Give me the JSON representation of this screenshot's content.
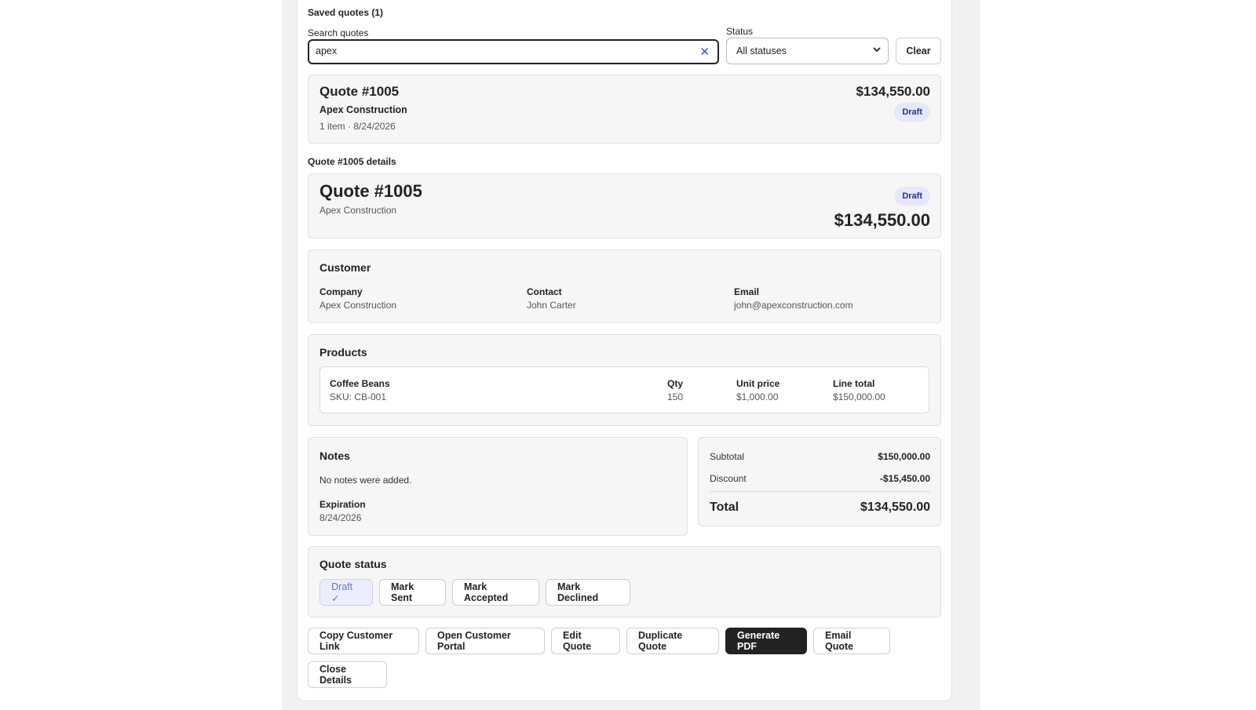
{
  "saved_quotes": {
    "heading": "Saved quotes (1)",
    "search_label": "Search quotes",
    "search_value": "apex",
    "status_label": "Status",
    "status_selected": "All statuses",
    "clear_label": "Clear"
  },
  "quote_card": {
    "title": "Quote #1005",
    "company": "Apex Construction",
    "meta": "1 item · 8/24/2026",
    "amount": "$134,550.00",
    "status": "Draft"
  },
  "details": {
    "heading": "Quote #1005 details",
    "title": "Quote #1005",
    "company": "Apex Construction",
    "status": "Draft",
    "amount": "$134,550.00"
  },
  "customer": {
    "heading": "Customer",
    "company_label": "Company",
    "company_value": "Apex Construction",
    "contact_label": "Contact",
    "contact_value": "John Carter",
    "email_label": "Email",
    "email_value": "john@apexconstruction.com"
  },
  "products": {
    "heading": "Products",
    "items": [
      {
        "name": "Coffee Beans",
        "sku": "SKU: CB-001",
        "qty_label": "Qty",
        "qty": "150",
        "unit_price_label": "Unit price",
        "unit_price": "$1,000.00",
        "line_total_label": "Line total",
        "line_total": "$150,000.00"
      }
    ]
  },
  "notes": {
    "heading": "Notes",
    "text": "No notes were added.",
    "expiration_label": "Expiration",
    "expiration_value": "8/24/2026"
  },
  "totals": {
    "subtotal_label": "Subtotal",
    "subtotal_value": "$150,000.00",
    "discount_label": "Discount",
    "discount_value": "-$15,450.00",
    "total_label": "Total",
    "total_value": "$134,550.00"
  },
  "quote_status": {
    "heading": "Quote status",
    "draft_label": "Draft ✓",
    "mark_sent": "Mark Sent",
    "mark_accepted": "Mark Accepted",
    "mark_declined": "Mark Declined"
  },
  "actions": {
    "copy_link": "Copy Customer Link",
    "open_portal": "Open Customer Portal",
    "edit": "Edit Quote",
    "duplicate": "Duplicate Quote",
    "generate_pdf": "Generate PDF",
    "email": "Email Quote",
    "close": "Close Details"
  },
  "icons": {
    "clear_search": "close-icon",
    "select_chevron": "chevron-down-icon"
  },
  "colors": {
    "badge_bg": "#e6e8fb",
    "badge_text": "#2a2f8f",
    "primary_dark": "#232323",
    "clear_x": "#3a57c4"
  }
}
